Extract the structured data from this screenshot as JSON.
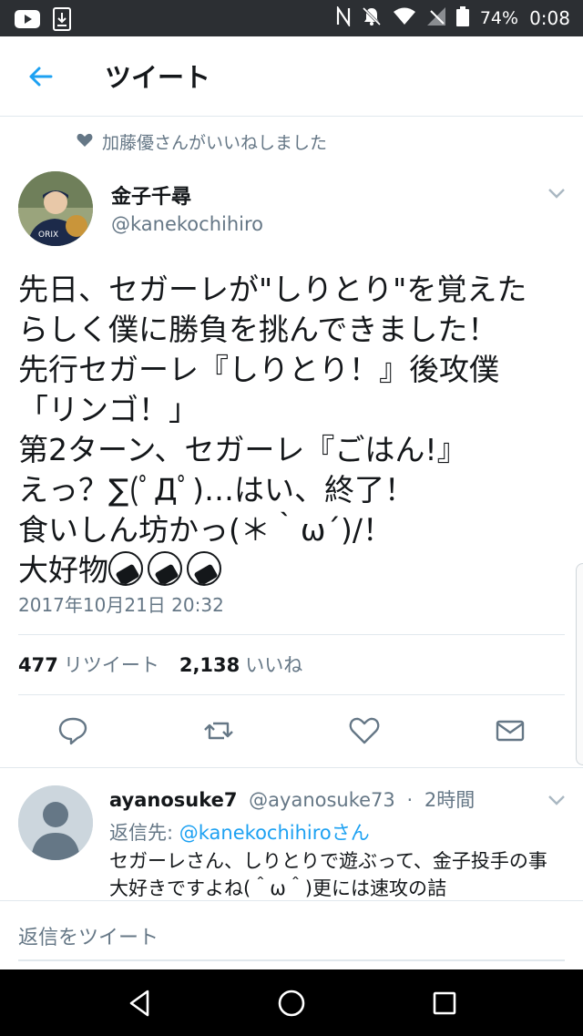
{
  "status_bar": {
    "battery": "74%",
    "time": "0:08"
  },
  "header": {
    "title": "ツイート"
  },
  "social_context": {
    "text": "加藤優さんがいいねしました"
  },
  "tweet": {
    "author_name": "金子千尋",
    "author_handle": "@kanekochihiro",
    "lines": [
      "先日、セガーレが\"しりとり\"を覚えた",
      "らしく僕に勝負を挑んできました！",
      "先行セガーレ『しりとり！』後攻僕",
      "「リンゴ！」",
      "第2ターン、セガーレ『ごはん!』",
      "えっ？∑(ﾟДﾟ)…はい、終了！",
      "食いしん坊かっ(＊｀ω´)/！",
      "大好物"
    ],
    "timestamp": "2017年10月21日 20:32",
    "retweet_count": "477",
    "retweet_label": "リツイート",
    "like_count": "2,138",
    "like_label": "いいね"
  },
  "reply": {
    "name": "ayanosuke7",
    "handle": "@ayanosuke73",
    "separator": "·",
    "time": "2時間",
    "reply_to_label": "返信先:",
    "reply_to_handle": "@kanekochihiroさん",
    "text": "セガーレさん、しりとりで遊ぶって、金子投手の事大好きですよね(＾ω＾)更には速攻の詰"
  },
  "reply_bar": {
    "placeholder": "返信をツイート"
  },
  "colors": {
    "accent": "#1da1f2",
    "muted": "#657786",
    "divider": "#e1e8ed",
    "status_bar": "#2c2f33"
  }
}
